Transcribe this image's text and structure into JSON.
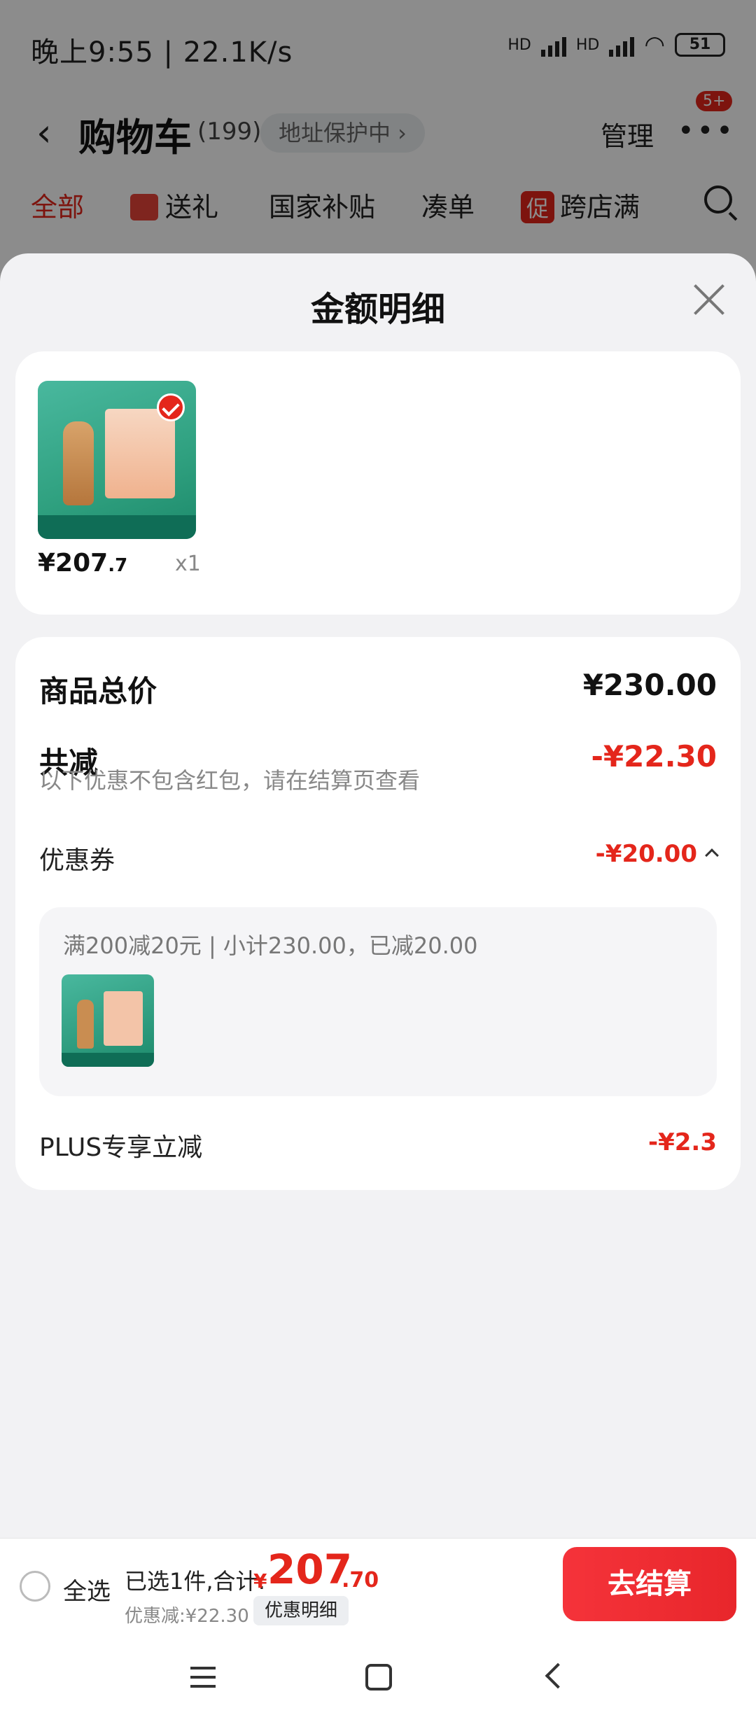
{
  "status_bar": {
    "time": "晚上9:55 | 22.1K/s",
    "network_label": "HD",
    "battery": "51"
  },
  "cart_header": {
    "title": "购物车",
    "count": "(199)",
    "address_protect": "地址保护中 ›",
    "manage": "管理",
    "more_badge": "5+"
  },
  "cart_tabs": {
    "all": "全部",
    "gift": "送礼",
    "subsidy": "国家补贴",
    "combine": "凑单",
    "promo_tag": "促",
    "cross_store": "跨店满"
  },
  "sheet": {
    "title": "金额明细"
  },
  "item": {
    "price_int": "¥207",
    "price_dec": ".7",
    "quantity": "x1"
  },
  "details": {
    "total_label": "商品总价",
    "total_value": "¥230.00",
    "reduce_label": "共减",
    "reduce_value": "-¥22.30",
    "reduce_note": "以下优惠不包含红包，请在结算页查看",
    "coupon_label": "优惠券",
    "coupon_value": "-¥20.00",
    "coupon_desc": "满200减20元 | 小计230.00，已减20.00",
    "plus_label": "PLUS专享立减",
    "plus_value": "-¥2.3"
  },
  "bottom_bar": {
    "select_all": "全选",
    "selected_summary": "已选1件,合计:",
    "currency": "¥",
    "total_int": "207",
    "total_dec": ".70",
    "discount": "优惠减:¥22.30",
    "detail_chip": "优惠明细",
    "checkout": "去结算"
  },
  "colors": {
    "accent_red": "#e4261b",
    "product_green": "#2fa07f"
  }
}
